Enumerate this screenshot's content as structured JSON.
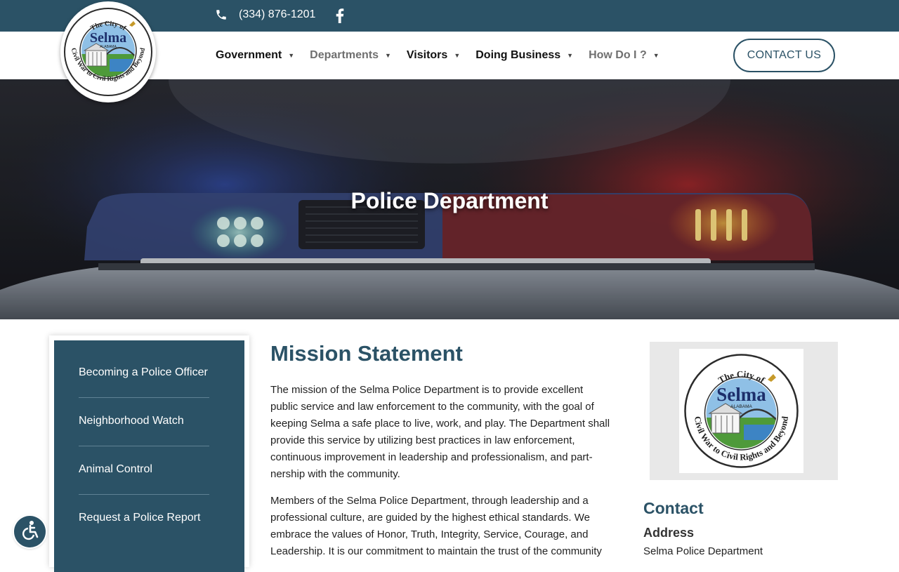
{
  "topbar": {
    "phone": "(334) 876-1201",
    "facebook_icon": "facebook-icon"
  },
  "logo": {
    "arc_top": "The City of",
    "name": "Selma",
    "state": "ALABAMA",
    "arc_bottom": "Civil War to Civil Rights and Beyond"
  },
  "nav": {
    "items": [
      {
        "label": "Government"
      },
      {
        "label": "Departments"
      },
      {
        "label": "Visitors"
      },
      {
        "label": "Doing Business"
      },
      {
        "label": "How Do I ?"
      }
    ],
    "caret": "▼",
    "contact_button": "CONTACT US"
  },
  "hero": {
    "title": "Police Department"
  },
  "sidebar": {
    "links": [
      {
        "label": "Becoming a Police Officer"
      },
      {
        "label": "Neighborhood Watch"
      },
      {
        "label": "Animal Control"
      },
      {
        "label": "Request a Police Report"
      }
    ]
  },
  "main": {
    "heading": "Mission Statement",
    "p1_lines": [
      "The mission of the Selma Police Department is to provide excellent",
      "public service and law enforcement to the community, with the goal of",
      "keeping Selma a safe place to live, work, and play. The Department shall",
      "provide this service by utilizing best practices in law enforcement,",
      "continuous improvement in leadership and professionalism, and part-",
      "nership with the community."
    ],
    "p2_lines": [
      "Members of the Selma Police Department, through leadership and a",
      "professional culture, are guided by the highest ethical standards. We",
      "embrace the values of Honor, Truth, Integrity, Service, Courage, and",
      "Leadership. It is our commitment to maintain the trust of the community"
    ]
  },
  "right": {
    "contact_heading": "Contact",
    "address_heading": "Address",
    "address_line1": "Selma Police Department"
  },
  "colors": {
    "brand": "#2b5266",
    "muted_nav": "#6f6f6f"
  }
}
